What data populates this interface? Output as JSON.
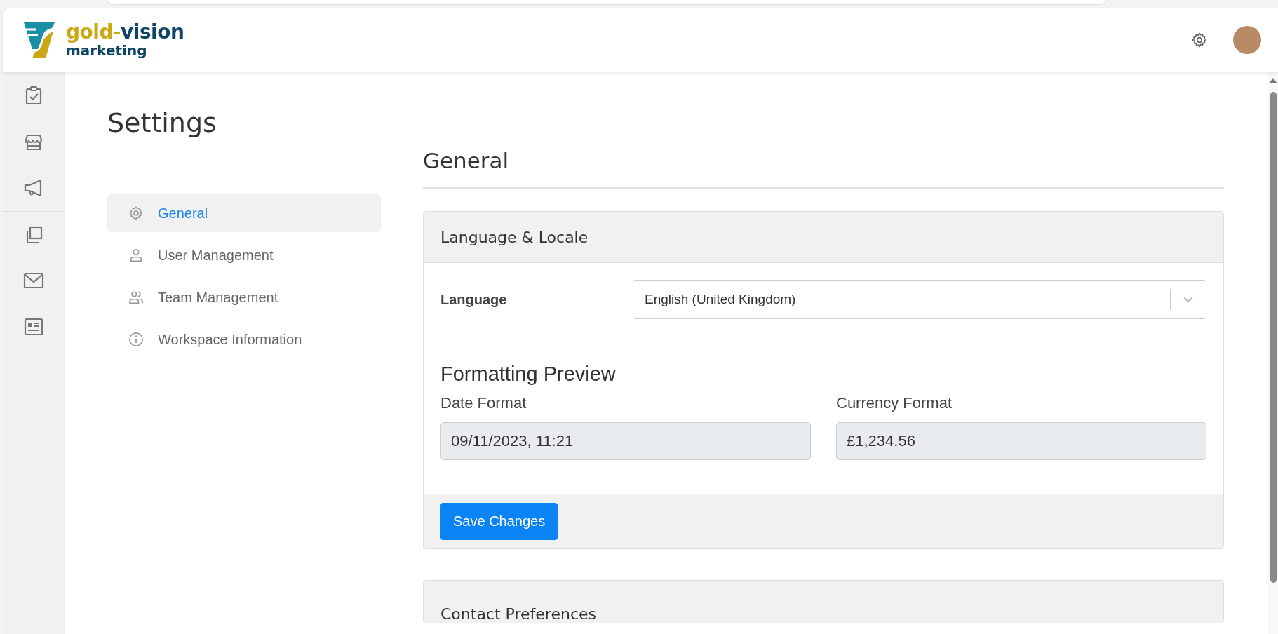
{
  "header": {
    "logo": {
      "word_1": "gold-",
      "word_2": "vision",
      "tagline": "marketing"
    }
  },
  "sidebar": {
    "items": [
      {
        "kind": "clipboard"
      },
      {
        "kind": "store"
      },
      {
        "kind": "megaphone"
      },
      {
        "kind": "copy"
      },
      {
        "kind": "mail"
      },
      {
        "kind": "newspaper"
      }
    ]
  },
  "page_title": "Settings",
  "settings_nav": [
    {
      "label": "General",
      "kind": "gear",
      "selected": true
    },
    {
      "label": "User Management",
      "kind": "user",
      "selected": false
    },
    {
      "label": "Team Management",
      "kind": "team",
      "selected": false
    },
    {
      "label": "Workspace Information",
      "kind": "info",
      "selected": false
    }
  ],
  "section_title": "General",
  "language_card": {
    "title": "Language & Locale",
    "language_label": "Language",
    "language_value": "English (United Kingdom)",
    "preview_title": "Formatting Preview",
    "fields": [
      {
        "label": "Date Format",
        "value": "09/11/2023, 11:21"
      },
      {
        "label": "Currency Format",
        "value": "£1,234.56"
      }
    ],
    "save_button": "Save Changes"
  },
  "contact_card": {
    "title": "Contact Preferences"
  }
}
